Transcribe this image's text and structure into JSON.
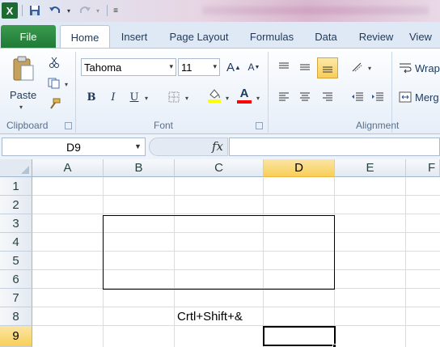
{
  "quick_access": {
    "app_icon": "excel-logo-icon",
    "save": "save-icon",
    "undo": "undo-icon",
    "redo": "redo-icon",
    "customize": "customize-qat-icon"
  },
  "tabs": [
    {
      "label": "File"
    },
    {
      "label": "Home"
    },
    {
      "label": "Insert"
    },
    {
      "label": "Page Layout"
    },
    {
      "label": "Formulas"
    },
    {
      "label": "Data"
    },
    {
      "label": "Review"
    },
    {
      "label": "View"
    }
  ],
  "ribbon": {
    "clipboard": {
      "label": "Clipboard",
      "paste_label": "Paste"
    },
    "font": {
      "label": "Font",
      "font_name": "Tahoma",
      "font_size": "11",
      "bold": "B",
      "italic": "I",
      "underline": "U",
      "grow": "A",
      "shrink": "A",
      "font_color_letter": "A"
    },
    "alignment": {
      "label": "Alignment",
      "wrap_label": "Wrap",
      "merge_label": "Merg"
    }
  },
  "formula_bar": {
    "name_box": "D9",
    "fx": "fx",
    "formula": ""
  },
  "grid": {
    "columns": [
      "A",
      "B",
      "C",
      "D",
      "E",
      "F"
    ],
    "selected_column": "D",
    "rows": [
      "1",
      "2",
      "3",
      "4",
      "5",
      "6",
      "7",
      "8",
      "9"
    ],
    "selected_row": "9",
    "cell_text": "Crtl+Shift+&"
  },
  "colors": {
    "file_tab": "#1f7a36",
    "selection_header": "#f7cf58",
    "highlight_yellow": "#ffff00",
    "font_red": "#ff0000"
  }
}
